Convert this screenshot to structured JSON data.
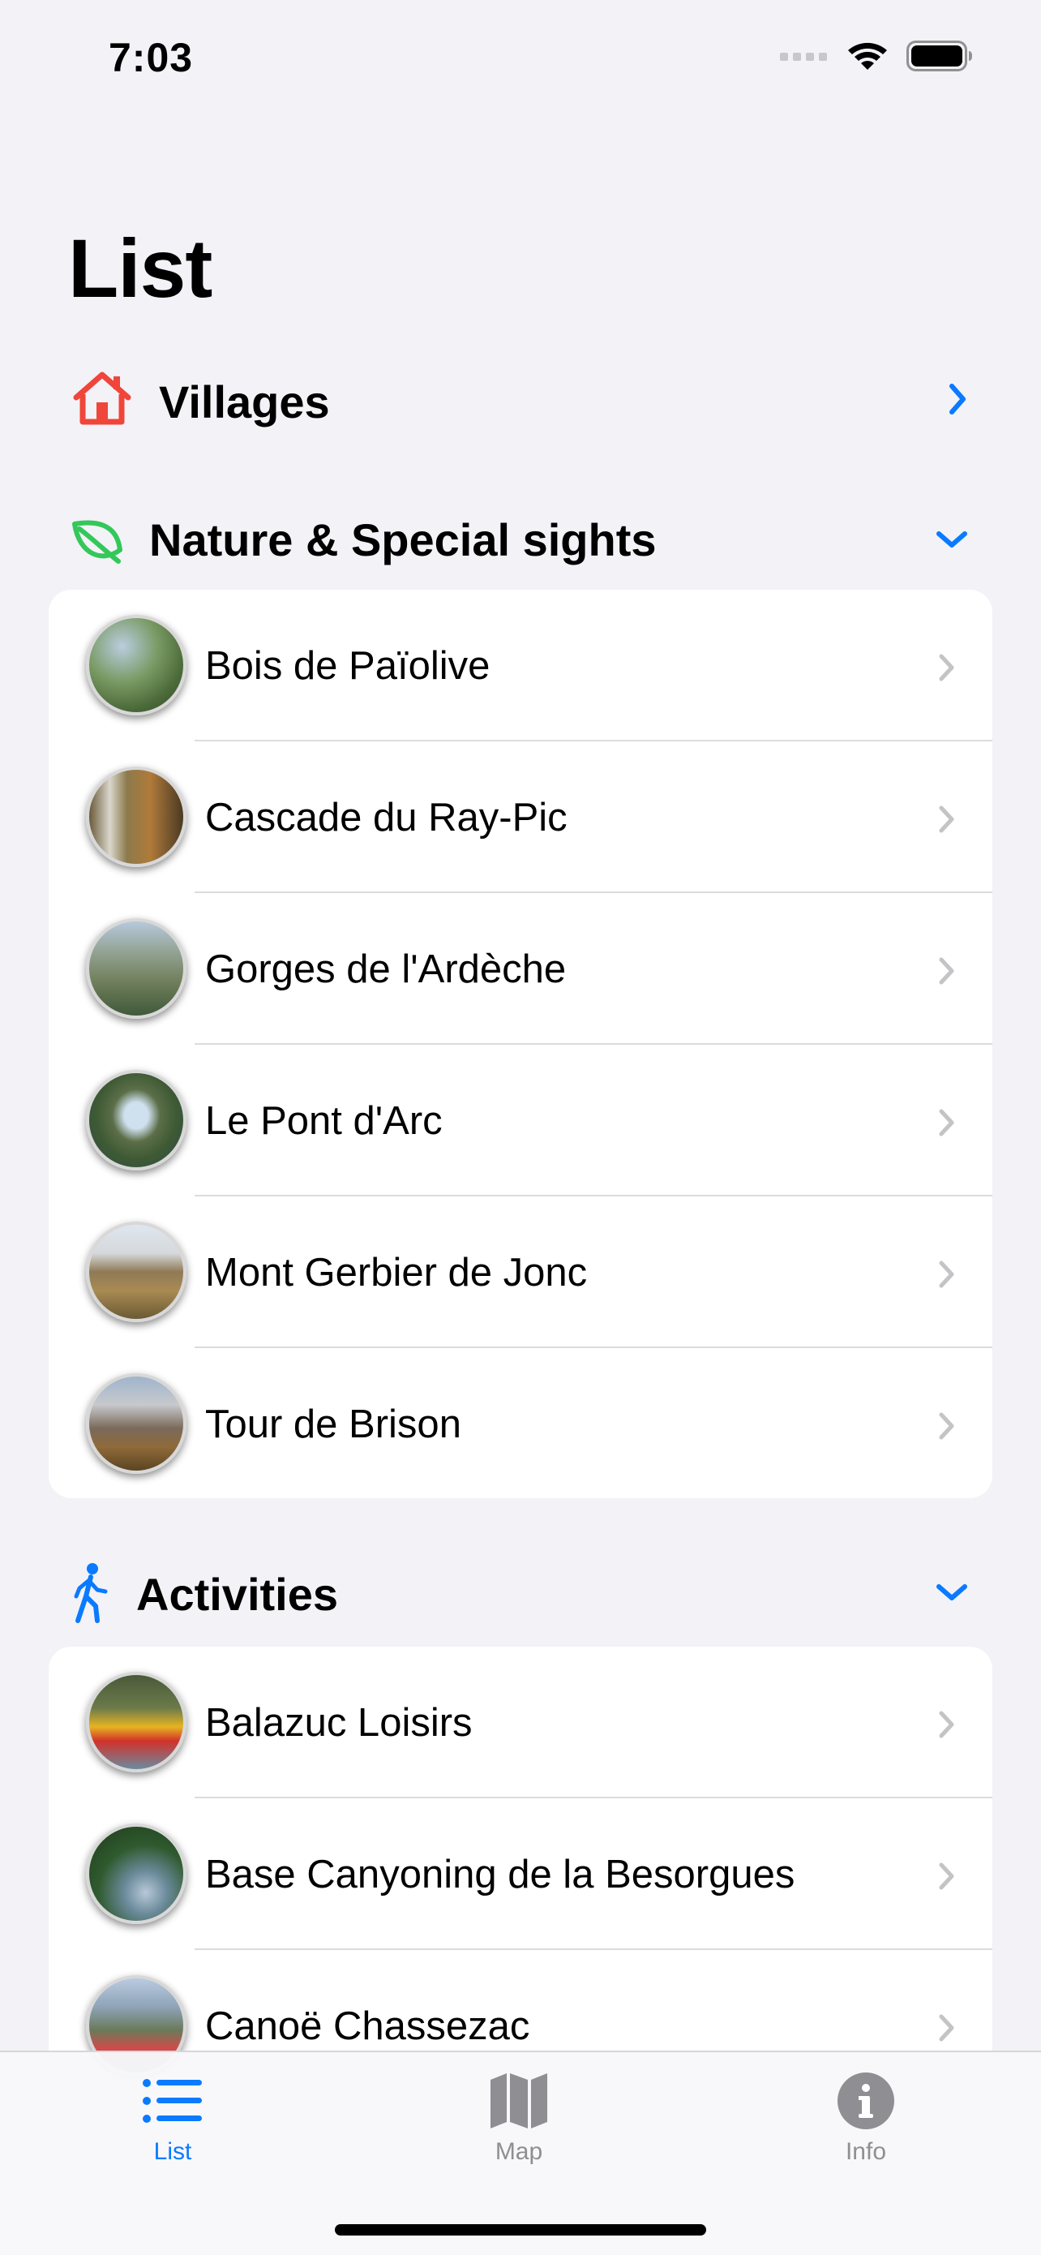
{
  "status_bar": {
    "time": "7:03"
  },
  "page_title": "List",
  "colors": {
    "accent": "#0a7aff",
    "home_icon": "#f0453a",
    "leaf_icon": "#34c759",
    "chevron_gray": "#c4c4c7",
    "tab_inactive": "#8e8e93"
  },
  "sections": [
    {
      "label": "Villages",
      "icon": "house-icon",
      "expanded": false
    },
    {
      "label": "Nature & Special sights",
      "icon": "leaf-icon",
      "expanded": true,
      "items": [
        {
          "label": "Bois de Païolive",
          "thumb": "forest-gorge"
        },
        {
          "label": "Cascade du Ray-Pic",
          "thumb": "waterfall"
        },
        {
          "label": "Gorges de l'Ardèche",
          "thumb": "canyon"
        },
        {
          "label": "Le Pont d'Arc",
          "thumb": "stone-arch"
        },
        {
          "label": "Mont Gerbier de Jonc",
          "thumb": "mountain"
        },
        {
          "label": "Tour de Brison",
          "thumb": "hill-landscape"
        }
      ]
    },
    {
      "label": "Activities",
      "icon": "walking-figure-icon",
      "expanded": true,
      "items": [
        {
          "label": "Balazuc Loisirs",
          "thumb": "kayak"
        },
        {
          "label": "Base Canyoning de la Besorgues",
          "thumb": "river-canyoning"
        },
        {
          "label": "Canoë Chassezac",
          "thumb": "canoe"
        }
      ]
    }
  ],
  "tabs": [
    {
      "label": "List",
      "icon": "list-bullet-icon",
      "selected": true
    },
    {
      "label": "Map",
      "icon": "map-icon",
      "selected": false
    },
    {
      "label": "Info",
      "icon": "info-circle-icon",
      "selected": false
    }
  ]
}
